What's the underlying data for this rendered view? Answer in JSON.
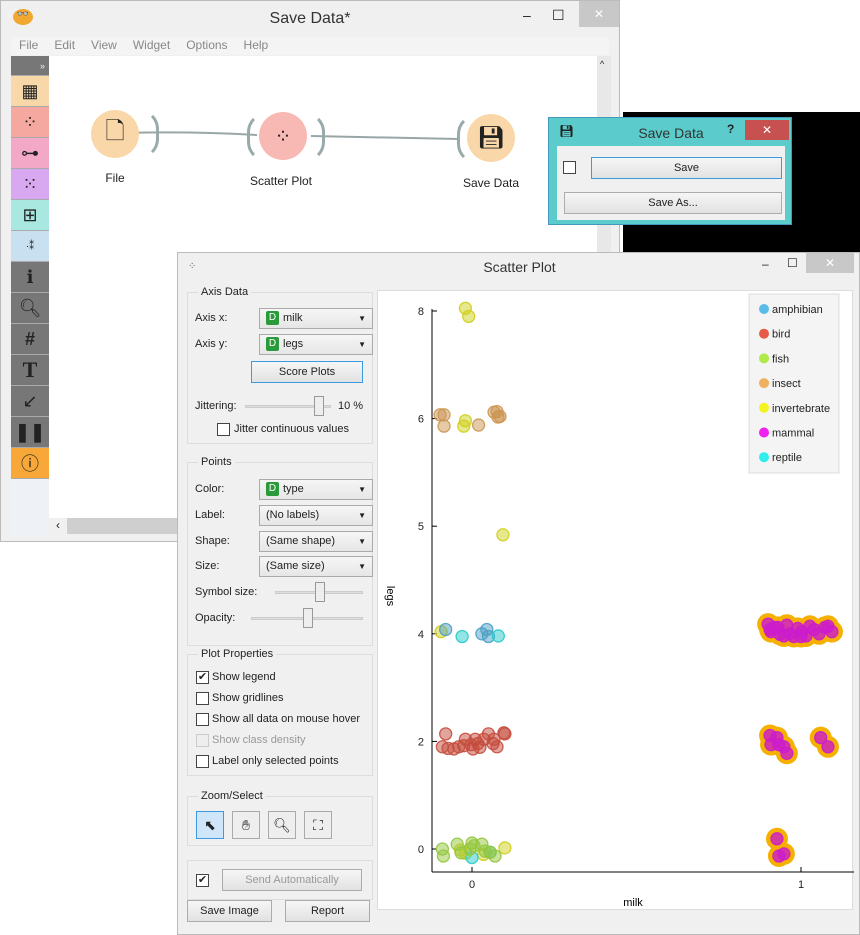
{
  "main_window": {
    "title": "Save Data*",
    "menu": [
      "File",
      "Edit",
      "View",
      "Widget",
      "Options",
      "Help"
    ],
    "nodes": [
      {
        "label": "File"
      },
      {
        "label": "Scatter Plot"
      },
      {
        "label": "Save Data"
      }
    ]
  },
  "save_dialog": {
    "title": "Save Data",
    "help": "?",
    "save": "Save",
    "save_as": "Save As..."
  },
  "scatter": {
    "title": "Scatter Plot",
    "axis_data": {
      "title": "Axis Data",
      "axis_x_label": "Axis x:",
      "axis_x": "milk",
      "axis_y_label": "Axis y:",
      "axis_y": "legs",
      "score_plots": "Score Plots",
      "jitter_label": "Jittering:",
      "jitter_value": "10 %",
      "jitter_fraction": 0.9,
      "jitter_continuous": "Jitter continuous values"
    },
    "points": {
      "title": "Points",
      "color_label": "Color:",
      "color": "type",
      "label_label": "Label:",
      "label": "(No labels)",
      "shape_label": "Shape:",
      "shape": "(Same shape)",
      "size_label": "Size:",
      "size": "(Same size)",
      "symbol_size_label": "Symbol size:",
      "symbol_size_fraction": 0.5,
      "opacity_label": "Opacity:",
      "opacity_fraction": 0.5
    },
    "plot_properties": {
      "title": "Plot Properties",
      "items": [
        {
          "label": "Show legend",
          "checked": true
        },
        {
          "label": "Show gridlines",
          "checked": false
        },
        {
          "label": "Show all data on mouse hover",
          "checked": false
        },
        {
          "label": "Show class density",
          "checked": false,
          "disabled": true
        },
        {
          "label": "Label only selected points",
          "checked": false
        }
      ]
    },
    "zoom_select": {
      "title": "Zoom/Select"
    },
    "send_auto": "Send Automatically",
    "save_image": "Save Image",
    "report": "Report"
  },
  "chart_data": {
    "type": "scatter",
    "xlabel": "milk",
    "ylabel": "legs",
    "xticks": [
      "0",
      "1"
    ],
    "yticks": [
      "0",
      "2",
      "4",
      "5",
      "6",
      "8"
    ],
    "xlim": [
      -0.12,
      1.12
    ],
    "legend": [
      {
        "name": "amphibian",
        "color": "#5bbbe8"
      },
      {
        "name": "bird",
        "color": "#e85a48"
      },
      {
        "name": "fish",
        "color": "#aeea48"
      },
      {
        "name": "insect",
        "color": "#f0b060"
      },
      {
        "name": "invertebrate",
        "color": "#f4f420"
      },
      {
        "name": "mammal",
        "color": "#f020f0"
      },
      {
        "name": "reptile",
        "color": "#30eeee"
      }
    ],
    "selected_color": "#f5b000",
    "series": [
      {
        "name": "invertebrate",
        "points": [
          [
            -0.02,
            8.05
          ],
          [
            -0.01,
            7.9
          ],
          [
            -0.02,
            5.98
          ],
          [
            -0.025,
            5.93
          ],
          [
            0.094,
            4.92
          ],
          [
            -0.094,
            4.02
          ],
          [
            -0.035,
            -0.02
          ],
          [
            -0.02,
            -0.08
          ],
          [
            0.035,
            -0.1
          ],
          [
            0.1,
            0.02
          ]
        ]
      },
      {
        "name": "insect",
        "points": [
          [
            -0.097,
            6.07
          ],
          [
            -0.085,
            6.07
          ],
          [
            -0.085,
            5.93
          ],
          [
            0.02,
            5.94
          ],
          [
            0.067,
            6.12
          ],
          [
            0.076,
            6.13
          ],
          [
            0.079,
            6.03
          ],
          [
            0.085,
            6.04
          ]
        ]
      },
      {
        "name": "amphibian",
        "points": [
          [
            -0.08,
            4.04
          ],
          [
            0.03,
            4.0
          ],
          [
            0.045,
            4.04
          ],
          [
            0.05,
            3.95
          ]
        ]
      },
      {
        "name": "reptile",
        "points": [
          [
            -0.03,
            3.95
          ],
          [
            0.08,
            3.96
          ],
          [
            0.0,
            -0.16
          ],
          [
            0.055,
            -0.06
          ]
        ]
      },
      {
        "name": "bird",
        "points": [
          [
            -0.08,
            2.14
          ],
          [
            -0.09,
            1.9
          ],
          [
            -0.073,
            1.87
          ],
          [
            -0.055,
            1.86
          ],
          [
            -0.04,
            1.9
          ],
          [
            -0.025,
            1.92
          ],
          [
            -0.02,
            2.04
          ],
          [
            -0.003,
            1.94
          ],
          [
            0.003,
            1.86
          ],
          [
            0.01,
            2.04
          ],
          [
            0.018,
            1.96
          ],
          [
            0.024,
            1.89
          ],
          [
            0.036,
            2.04
          ],
          [
            0.05,
            2.14
          ],
          [
            0.064,
            1.96
          ],
          [
            0.067,
            2.04
          ],
          [
            0.076,
            1.9
          ],
          [
            0.097,
            2.16
          ],
          [
            0.1,
            2.14
          ]
        ]
      },
      {
        "name": "fish",
        "points": [
          [
            -0.09,
            0.0
          ],
          [
            -0.087,
            -0.13
          ],
          [
            -0.045,
            0.09
          ],
          [
            -0.033,
            -0.07
          ],
          [
            0.0,
            0.11
          ],
          [
            -0.006,
            0.0
          ],
          [
            0.03,
            0.09
          ],
          [
            0.04,
            -0.04
          ],
          [
            0.055,
            -0.06
          ],
          [
            0.07,
            -0.13
          ],
          [
            0.006,
            0.06
          ]
        ]
      },
      {
        "name": "mammal",
        "selected": true,
        "points": [
          [
            0.9,
            4.09
          ],
          [
            0.909,
            4.02
          ],
          [
            0.92,
            4.06
          ],
          [
            0.936,
            3.99
          ],
          [
            0.957,
            4.08
          ],
          [
            0.966,
            4.0
          ],
          [
            0.978,
            3.95
          ],
          [
            0.99,
            4.05
          ],
          [
            1.003,
            4.02
          ],
          [
            1.015,
            3.96
          ],
          [
            1.027,
            4.07
          ],
          [
            1.04,
            4.04
          ],
          [
            1.055,
            4.0
          ],
          [
            1.073,
            4.06
          ],
          [
            1.082,
            4.07
          ],
          [
            1.094,
            4.02
          ],
          [
            0.906,
            4.04
          ],
          [
            0.93,
            4.06
          ],
          [
            0.948,
            3.96
          ],
          [
            1.0,
            3.95
          ],
          [
            0.906,
            2.11
          ],
          [
            0.927,
            2.07
          ],
          [
            0.909,
            1.94
          ],
          [
            0.933,
            1.94
          ],
          [
            0.948,
            1.9
          ],
          [
            0.957,
            1.78
          ],
          [
            1.06,
            2.07
          ],
          [
            1.082,
            1.9
          ],
          [
            0.927,
            0.19
          ],
          [
            0.933,
            -0.13
          ],
          [
            0.948,
            -0.09
          ]
        ]
      }
    ]
  }
}
